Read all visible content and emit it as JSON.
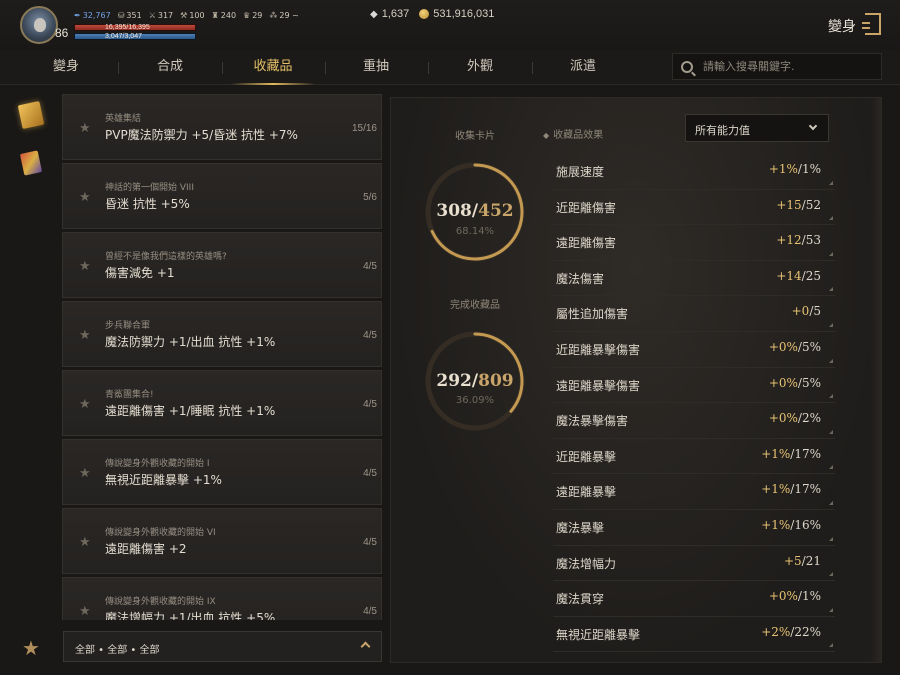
{
  "player": {
    "level": "86",
    "stats": [
      {
        "icon": "feather-icon",
        "glyph": "✒",
        "value": "32,767",
        "blue": true
      },
      {
        "icon": "coin-stack-icon",
        "glyph": "⛁",
        "value": "351"
      },
      {
        "icon": "sword-icon",
        "glyph": "⚔",
        "value": "317"
      },
      {
        "icon": "pickaxe-icon",
        "glyph": "⚒",
        "value": "100"
      },
      {
        "icon": "bag-icon",
        "glyph": "♜",
        "value": "240"
      },
      {
        "icon": "trophy-icon",
        "glyph": "♛",
        "value": "29"
      },
      {
        "icon": "shard-icon",
        "glyph": "⁂",
        "value": "29 ~"
      }
    ],
    "hp_text": "16,395/16,395",
    "hp_fraction": 1.0,
    "mp_text": "3,047/3,047",
    "mp_fraction": 1.0
  },
  "currency": {
    "gems": "1,637",
    "gold": "531,916,031"
  },
  "header": {
    "title": "變身"
  },
  "tabs": [
    {
      "label": "變身",
      "active": false
    },
    {
      "label": "合成",
      "active": false
    },
    {
      "label": "收藏品",
      "active": true
    },
    {
      "label": "重抽",
      "active": false
    },
    {
      "label": "外觀",
      "active": false
    },
    {
      "label": "派遣",
      "active": false
    }
  ],
  "search": {
    "placeholder": "請輸入搜尋關鍵字."
  },
  "collections": [
    {
      "name": "英雄集結",
      "effect": "PVP魔法防禦力 +5/昏迷 抗性 +7%",
      "count": "15/16"
    },
    {
      "name": "神話的第一個開始 VIII",
      "effect": "昏迷 抗性 +5%",
      "count": "5/6"
    },
    {
      "name": "曾經不是像我們這樣的英雄嗎?",
      "effect": "傷害減免 +1",
      "count": "4/5"
    },
    {
      "name": "步兵聯合軍",
      "effect": "魔法防禦力 +1/出血 抗性 +1%",
      "count": "4/5"
    },
    {
      "name": "青鯊團集合!",
      "effect": "遠距離傷害 +1/睡眠 抗性 +1%",
      "count": "4/5"
    },
    {
      "name": "傳說變身外觀收藏的開始 I",
      "effect": "無視近距離暴擊 +1%",
      "count": "4/5"
    },
    {
      "name": "傳說變身外觀收藏的開始 VI",
      "effect": "遠距離傷害 +2",
      "count": "4/5"
    },
    {
      "name": "傳說變身外觀收藏的開始 IX",
      "effect": "魔法增幅力 +1/出血 抗性 +5%",
      "count": "4/5"
    }
  ],
  "filter": {
    "label": "全部 • 全部 • 全部"
  },
  "summary": {
    "cards_label": "收集卡片",
    "cards_current": "308",
    "cards_total": "452",
    "cards_fraction": 0.6814,
    "cards_pct": "68.14%",
    "complete_label": "完成收藏品",
    "complete_current": "292",
    "complete_total": "809",
    "complete_fraction": 0.3609,
    "complete_pct": "36.09%"
  },
  "effects_panel": {
    "heading": "收藏品效果",
    "dropdown": "所有能力值",
    "rows": [
      {
        "label": "施展速度",
        "current": "+1%",
        "max": "1%"
      },
      {
        "label": "近距離傷害",
        "current": "+15",
        "max": "52"
      },
      {
        "label": "遠距離傷害",
        "current": "+12",
        "max": "53"
      },
      {
        "label": "魔法傷害",
        "current": "+14",
        "max": "25"
      },
      {
        "label": "屬性追加傷害",
        "current": "+0",
        "max": "5"
      },
      {
        "label": "近距離暴擊傷害",
        "current": "+0%",
        "max": "5%"
      },
      {
        "label": "遠距離暴擊傷害",
        "current": "+0%",
        "max": "5%"
      },
      {
        "label": "魔法暴擊傷害",
        "current": "+0%",
        "max": "2%"
      },
      {
        "label": "近距離暴擊",
        "current": "+1%",
        "max": "17%"
      },
      {
        "label": "遠距離暴擊",
        "current": "+1%",
        "max": "17%"
      },
      {
        "label": "魔法暴擊",
        "current": "+1%",
        "max": "16%"
      },
      {
        "label": "魔法增幅力",
        "current": "+5",
        "max": "21"
      },
      {
        "label": "魔法貫穿",
        "current": "+0%",
        "max": "1%"
      },
      {
        "label": "無視近距離暴擊",
        "current": "+2%",
        "max": "22%"
      }
    ]
  },
  "colors": {
    "accent_gold": "#e0b95e",
    "value_gold": "#e8c272",
    "hp_red": "#c0483a",
    "mp_blue": "#4d7fb8"
  }
}
